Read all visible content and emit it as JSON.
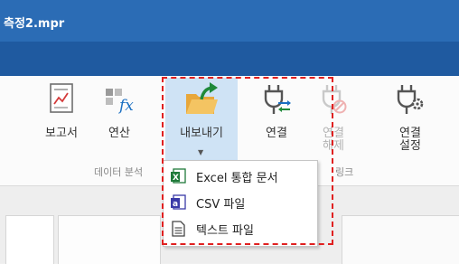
{
  "window": {
    "title": "측정2.mpr"
  },
  "ribbon": {
    "buttons": {
      "report": "보고서",
      "calc": "연산",
      "export": "내보내기",
      "connect": "연결",
      "disconnect_1": "연결",
      "disconnect_2": "해제",
      "conn_settings_1": "연결",
      "conn_settings_2": "설정"
    },
    "groups": {
      "data_analysis": "데이터 분석",
      "link_suffix": "링크"
    },
    "export_menu": {
      "items": [
        {
          "label": "Excel 통합 문서",
          "icon": "excel-icon"
        },
        {
          "label": "CSV 파일",
          "icon": "csv-icon"
        },
        {
          "label": "텍스트 파일",
          "icon": "text-file-icon"
        }
      ]
    }
  },
  "colors": {
    "titlebar": "#2b6cb5",
    "highlight": "#cfe3f5",
    "annotation": "#e02020",
    "accent_green": "#1f8a3a",
    "accent_blue": "#1a6fc2"
  }
}
